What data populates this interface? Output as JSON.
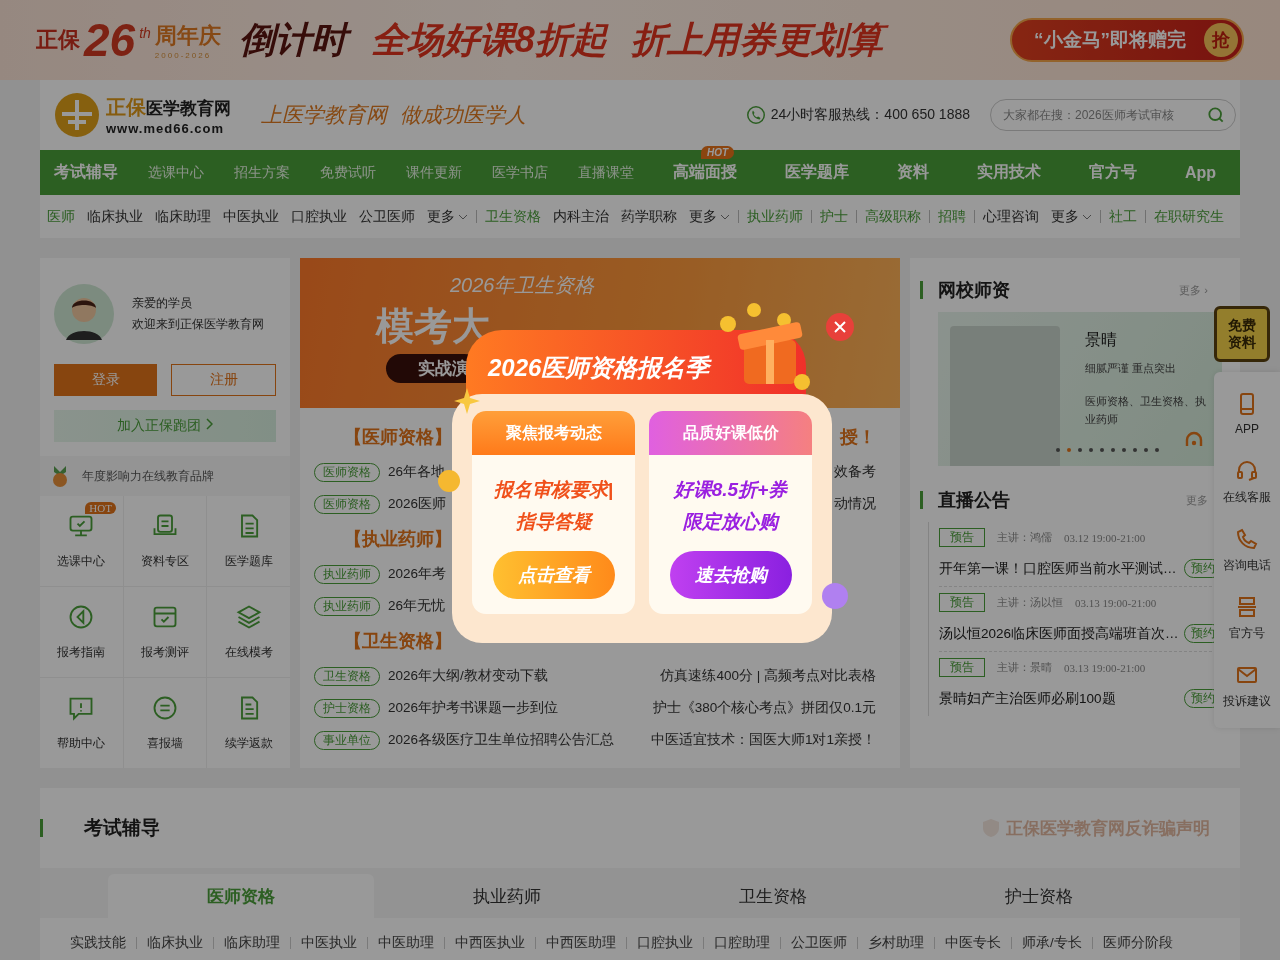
{
  "promo_banner": {
    "brand": "正保",
    "anniversary": "26",
    "anniversary_suffix": "th",
    "anniversary_label": "周年庆",
    "years": "2000-2026",
    "countdown": "倒计时",
    "headline": "全场好课8折起",
    "subline": "折上用券更划算",
    "cta": "“小金马”即将赠完",
    "cta_badge": "抢"
  },
  "header": {
    "logo_brand": "正保",
    "logo_name": "医学教育网",
    "logo_url": "www.med66.com",
    "slogan": "上医学教育网  做成功医学人",
    "hotline": "24小时客服热线：400 650 1888",
    "search": {
      "placeholder": "大家都在搜：2026医师考试审核"
    }
  },
  "main_nav": [
    {
      "label": "考试辅导",
      "selected": false,
      "kind": "primary"
    },
    {
      "label": "选课中心",
      "selected": false,
      "kind": "minor"
    },
    {
      "label": "招生方案",
      "selected": false,
      "kind": "minor"
    },
    {
      "label": "免费试听",
      "selected": false,
      "kind": "minor"
    },
    {
      "label": "课件更新",
      "selected": false,
      "kind": "minor"
    },
    {
      "label": "医学书店",
      "selected": false,
      "kind": "minor"
    },
    {
      "label": "直播课堂",
      "selected": false,
      "kind": "minor"
    },
    {
      "label": "高端面授",
      "selected": false,
      "kind": "major",
      "badge": "HOT"
    },
    {
      "label": "医学题库",
      "selected": false,
      "kind": "major"
    },
    {
      "label": "资料",
      "selected": false,
      "kind": "major"
    },
    {
      "label": "实用技术",
      "selected": false,
      "kind": "major"
    },
    {
      "label": "官方号",
      "selected": false,
      "kind": "major"
    },
    {
      "label": "App",
      "selected": false,
      "kind": "major"
    }
  ],
  "sub_nav": [
    {
      "items": [
        {
          "label": "医师",
          "kind": "category"
        },
        {
          "label": "临床执业",
          "kind": "link"
        },
        {
          "label": "临床助理",
          "kind": "link"
        },
        {
          "label": "中医执业",
          "kind": "link"
        },
        {
          "label": "口腔执业",
          "kind": "link"
        },
        {
          "label": "公卫医师",
          "kind": "link"
        },
        {
          "label": "更多",
          "kind": "more"
        }
      ]
    },
    {
      "items": [
        {
          "label": "卫生资格",
          "kind": "category"
        },
        {
          "label": "内科主治",
          "kind": "link"
        },
        {
          "label": "药学职称",
          "kind": "link"
        },
        {
          "label": "更多",
          "kind": "more"
        }
      ]
    },
    {
      "items": [
        {
          "label": "执业药师",
          "kind": "category"
        }
      ]
    },
    {
      "items": [
        {
          "label": "护士",
          "kind": "category"
        }
      ]
    },
    {
      "items": [
        {
          "label": "高级职称",
          "kind": "category"
        }
      ]
    },
    {
      "items": [
        {
          "label": "招聘",
          "kind": "category"
        }
      ]
    },
    {
      "items": [
        {
          "label": "心理咨询",
          "kind": "link"
        },
        {
          "label": "更多",
          "kind": "more"
        }
      ]
    },
    {
      "items": [
        {
          "label": "社工",
          "kind": "category"
        }
      ]
    },
    {
      "items": [
        {
          "label": "在职研究生",
          "kind": "category"
        }
      ]
    }
  ],
  "user_panel": {
    "greeting": "亲爱的学员",
    "welcome": "欢迎来到正保医学教育网",
    "login": "登录",
    "register": "注册",
    "join": "加入正保跑团",
    "brand_award": "年度影响力在线教育品牌"
  },
  "quick_links": [
    {
      "label": "选课中心",
      "badge": "HOT"
    },
    {
      "label": "资料专区"
    },
    {
      "label": "医学题库"
    },
    {
      "label": "报考指南"
    },
    {
      "label": "报考测评"
    },
    {
      "label": "在线模考"
    },
    {
      "label": "帮助中心"
    },
    {
      "label": "喜报墙"
    },
    {
      "label": "续学返款"
    }
  ],
  "banner": {
    "subtitle": "2026年卫生资格",
    "title": "模考大",
    "tag": "实战演"
  },
  "news": [
    {
      "heading": "【医师资格】",
      "heading_right": "授！",
      "items": [
        {
          "tag": "医师资格",
          "left": "26年各地",
          "right": "效备考"
        },
        {
          "tag": "医师资格",
          "left": "2026医师",
          "right": "动情况"
        }
      ]
    },
    {
      "heading": "【执业药师】",
      "items": [
        {
          "tag": "执业药师",
          "left": "2026年考"
        },
        {
          "tag": "执业药师",
          "left": "26年无忧"
        }
      ]
    },
    {
      "heading": "【卫生资格】",
      "items": [
        {
          "tag": "卫生资格",
          "left": "2026年大纲/教材变动下载",
          "right": "仿真速练400分 | 高频考点对比表格"
        },
        {
          "tag": "护士资格",
          "left": "2026年护考书课题一步到位",
          "right": "护士《380个核心考点》拼团仅0.1元"
        },
        {
          "tag": "事业单位",
          "left": "2026各级医疗卫生单位招聘公告汇总",
          "right": "中医适宜技术：国医大师1对1亲授！"
        }
      ]
    }
  ],
  "teachers": {
    "title": "网校师资",
    "more": "更多 ›",
    "name": "景晴",
    "motto": "细腻严谨 重点突出",
    "subjects": "医师资格、卫生资格、执业药师",
    "dots": [
      {
        "selected": false
      },
      {
        "selected": true
      },
      {
        "selected": false
      },
      {
        "selected": false
      },
      {
        "selected": false
      },
      {
        "selected": false
      },
      {
        "selected": false
      },
      {
        "selected": false
      },
      {
        "selected": false
      },
      {
        "selected": false
      }
    ]
  },
  "live": {
    "title": "直播公告",
    "more": "更多",
    "items": [
      {
        "tag": "预告",
        "speaker": "主讲：鸿儒",
        "time": "03.12 19:00-21:00",
        "title": "开年第一课！口腔医师当前水平测试…",
        "action": "预约"
      },
      {
        "tag": "预告",
        "speaker": "主讲：汤以恒",
        "time": "03.13 19:00-21:00",
        "title": "汤以恒2026临床医师面授高端班首次…",
        "action": "预约"
      },
      {
        "tag": "预告",
        "speaker": "主讲：景晴",
        "time": "03.13 19:00-21:00",
        "title": "景晴妇产主治医师必刷100题",
        "action": "预约"
      }
    ]
  },
  "float_gift": {
    "line1": "免费",
    "line2": "资料"
  },
  "side_tools": [
    {
      "label": "APP"
    },
    {
      "label": "在线客服"
    },
    {
      "label": "咨询电话"
    },
    {
      "label": "官方号"
    },
    {
      "label": "投诉建议"
    }
  ],
  "exam_section": {
    "title": "考试辅导",
    "notice": "正保医学教育网反诈骗声明",
    "tabs": [
      {
        "label": "医师资格",
        "selected": true
      },
      {
        "label": "执业药师",
        "selected": false
      },
      {
        "label": "卫生资格",
        "selected": false
      },
      {
        "label": "护士资格",
        "selected": false
      }
    ],
    "links": [
      "实践技能",
      "临床执业",
      "临床助理",
      "中医执业",
      "中医助理",
      "中西医执业",
      "中西医助理",
      "口腔执业",
      "口腔助理",
      "公卫医师",
      "乡村助理",
      "中医专长",
      "师承/专长",
      "医师分阶段"
    ]
  },
  "popup": {
    "title": "2026医师资格报名季",
    "cards": [
      {
        "kind": "orange",
        "header": "聚焦报考动态",
        "line1": "报名审核要求|",
        "line2": "指导答疑",
        "button": "点击查看"
      },
      {
        "kind": "purple",
        "header": "品质好课低价",
        "line1": "好课8.5折+券",
        "line2": "限定放心购",
        "button": "速去抢购"
      }
    ]
  }
}
